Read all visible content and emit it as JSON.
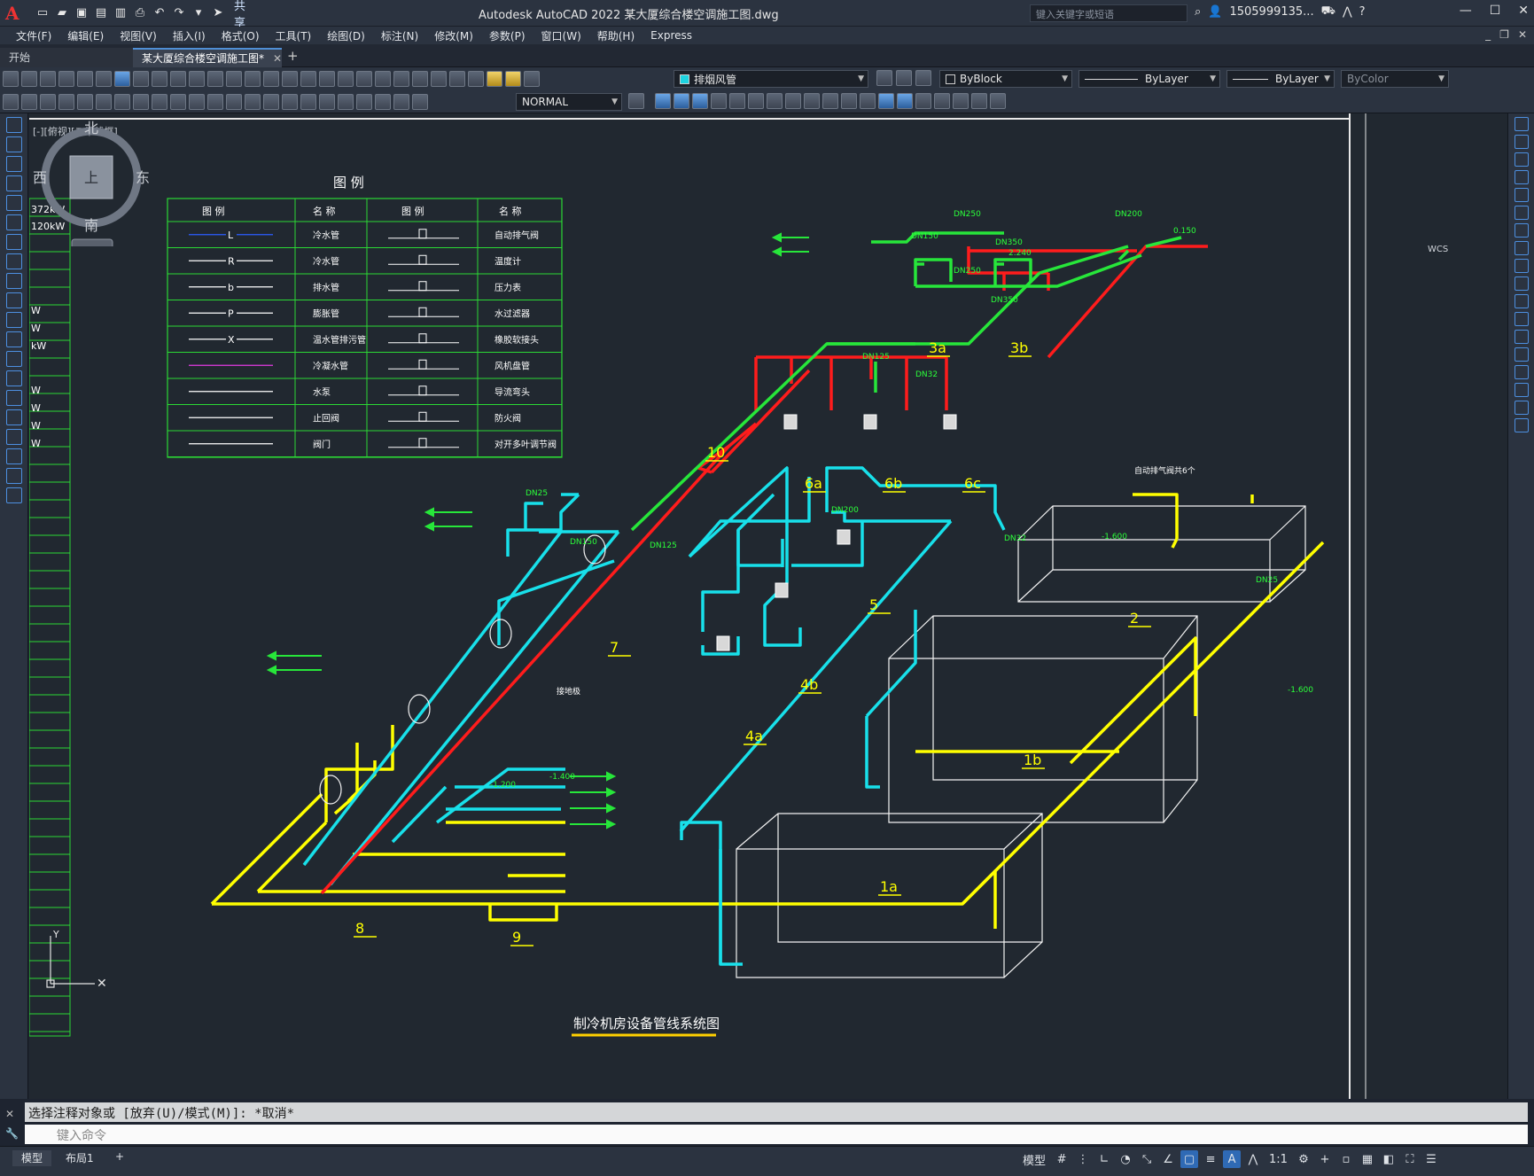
{
  "app": {
    "title": "Autodesk AutoCAD 2022    某大厦综合楼空调施工图.dwg",
    "logo": "A",
    "share": "共享",
    "search_placeholder": "键入关键字或短语",
    "user": "1505999135...",
    "colors": {
      "accent": "#4f8fd6",
      "canvas": "#212830",
      "chrome": "#2b3340"
    }
  },
  "menu": [
    "文件(F)",
    "编辑(E)",
    "视图(V)",
    "插入(I)",
    "格式(O)",
    "工具(T)",
    "绘图(D)",
    "标注(N)",
    "修改(M)",
    "参数(P)",
    "窗口(W)",
    "帮助(H)",
    "Express"
  ],
  "tabs": [
    {
      "label": "开始"
    },
    {
      "label": "某大厦综合楼空调施工图*"
    }
  ],
  "toolbar": {
    "layer": "排烟风管",
    "color": "ByBlock",
    "linetype": "ByLayer",
    "lineweight": "ByLayer",
    "plotstyle": "ByColor",
    "dimstyle": "NORMAL"
  },
  "view": {
    "label": "[-][俯视][二维线框]",
    "compass": {
      "n": "北",
      "s": "南",
      "e": "东",
      "w": "西",
      "top": "上",
      "wcs": "WCS"
    }
  },
  "left_table": [
    "372kW",
    "120kW",
    "W",
    "W",
    "kW",
    "W",
    "W",
    "W",
    "W"
  ],
  "legend": {
    "title": "图   例",
    "headers": [
      "图  例",
      "名  称",
      "图  例",
      "名  称"
    ],
    "rows": [
      {
        "sym": "L",
        "name1": "冷水管",
        "name2": "自动排气阀"
      },
      {
        "sym": "R",
        "name1": "冷水管",
        "name2": "温度计"
      },
      {
        "sym": "b",
        "name1": "排水管",
        "name2": "压力表"
      },
      {
        "sym": "P",
        "name1": "膨胀管",
        "name2": "水过滤器"
      },
      {
        "sym": "X",
        "name1": "温水管排污管",
        "name2": "橡胶软接头"
      },
      {
        "sym": "",
        "name1": "冷凝水管",
        "name2": "风机盘管"
      },
      {
        "sym": "",
        "name1": "水泵",
        "name2": "导流弯头"
      },
      {
        "sym": "",
        "name1": "止回阀",
        "name2": "防火阀"
      },
      {
        "sym": "",
        "name1": "阀门",
        "name2": "对开多叶调节阀"
      }
    ]
  },
  "drawing": {
    "title": "制冷机房设备管线系统图",
    "labels": [
      "10",
      "7",
      "8",
      "9",
      "5",
      "2",
      "1a",
      "1b",
      "3a",
      "3b",
      "6a",
      "6b",
      "6c",
      "4a",
      "4b"
    ],
    "dims": [
      "DN250",
      "DN200",
      "DN150",
      "DN350",
      "DN125",
      "DN32",
      "DN25",
      "-1.600",
      "-1.200",
      "-1.400",
      "2.240",
      "0.150"
    ],
    "notes": [
      "自动排气阀共6个",
      "接地极"
    ]
  },
  "command": {
    "history": "选择注释对象或 [放弃(U)/模式(M)]: *取消*",
    "placeholder": "键入命令"
  },
  "status": {
    "tabs": [
      "模型",
      "布局1"
    ],
    "mode": "模型",
    "scale": "1:1"
  }
}
